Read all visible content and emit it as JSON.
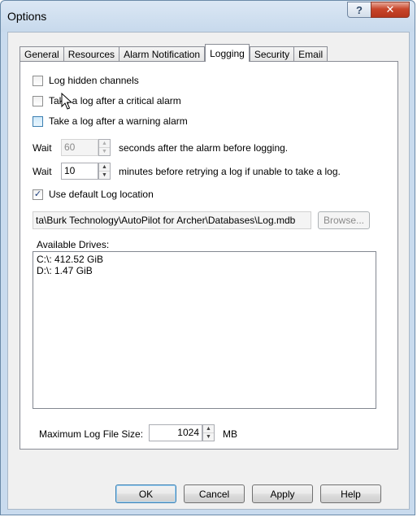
{
  "window": {
    "title": "Options",
    "help_glyph": "?",
    "close_glyph": "✕"
  },
  "tabs": [
    {
      "label": "General",
      "active": false
    },
    {
      "label": "Resources",
      "active": false
    },
    {
      "label": "Alarm Notification",
      "active": false
    },
    {
      "label": "Logging",
      "active": true
    },
    {
      "label": "Security",
      "active": false
    },
    {
      "label": "Email",
      "active": false
    }
  ],
  "logging": {
    "log_hidden_channels": {
      "label": "Log hidden channels",
      "checked": false
    },
    "critical_alarm": {
      "label": "Take a log after a critical alarm",
      "checked": false
    },
    "warning_alarm": {
      "label": "Take a log after a warning alarm",
      "checked": false
    },
    "wait_after_alarm": {
      "prefix": "Wait",
      "value": "60",
      "suffix": "seconds after the alarm before logging."
    },
    "wait_retry": {
      "prefix": "Wait",
      "value": "10",
      "suffix": "minutes before retrying a log if unable to take a log."
    },
    "default_location": {
      "label": "Use default Log location",
      "checked": true,
      "check_glyph": "✓"
    },
    "log_path": "ta\\Burk Technology\\AutoPilot for Archer\\Databases\\Log.mdb",
    "browse_label": "Browse...",
    "drives_label": "Available Drives:",
    "drives": [
      "C:\\: 412.52 GiB",
      "D:\\: 1.47 GiB"
    ],
    "max_size": {
      "label": "Maximum Log File Size:",
      "value": "1024",
      "unit": "MB"
    }
  },
  "footer": {
    "ok": "OK",
    "cancel": "Cancel",
    "apply": "Apply",
    "help": "Help"
  }
}
